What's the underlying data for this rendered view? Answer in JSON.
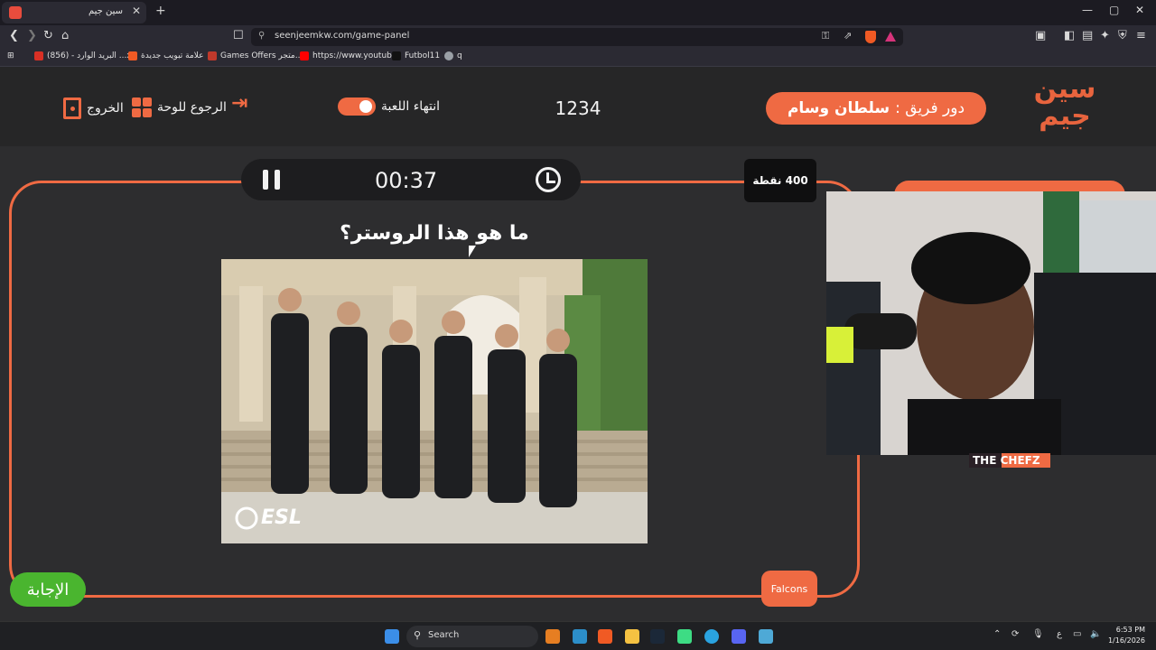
{
  "browser": {
    "tab_title": "سين جيم",
    "tab_close": "✕",
    "new_tab": "+",
    "url": "seenjeemkw.com/game-panel",
    "window_controls": [
      "—",
      "▢",
      "✕"
    ],
    "bookmarks": [
      {
        "label": "(856) - البريد الوارد ...x",
        "icon": "gmail-icon",
        "color": "#d93025"
      },
      {
        "label": "علامة تبويب جديدة",
        "icon": "brave-icon",
        "color": "#f05a24"
      },
      {
        "label": "Games Offers متجر...",
        "icon": "store-icon",
        "color": "#c0392b"
      },
      {
        "label": "https://www.youtub...",
        "icon": "youtube-icon",
        "color": "#ff0000"
      },
      {
        "label": "Futbol11",
        "icon": "futbol-icon",
        "color": "#111111"
      },
      {
        "label": "q",
        "icon": "globe-icon",
        "color": "#9aa0a6"
      }
    ]
  },
  "header": {
    "turn_prefix": "دور فريق :",
    "team_name": "سلطان وسام",
    "game_code": "1234",
    "end_game_label": "انتهاء اللعبة",
    "back_to_board_label": "الرجوع للوحة",
    "exit_label": "الخروج",
    "logo_line1": "سين",
    "logo_line2": "جيم"
  },
  "question": {
    "timer": "00:37",
    "points": "400 نقطة",
    "text": "ما هو هذا الروستر؟",
    "image_watermark": "ESL",
    "answer_button": "الإجابة",
    "team_button": "Falcons"
  },
  "webcam": {
    "overlay_text": "THE CHEFZ"
  },
  "taskbar": {
    "search_label": "Search",
    "time": "6:53 PM",
    "date": "1/16/2026",
    "lang": "ع"
  },
  "colors": {
    "accent": "#ef6a43",
    "answer_green": "#4ab52f",
    "background": "#2d2d2f",
    "header": "#262627"
  }
}
